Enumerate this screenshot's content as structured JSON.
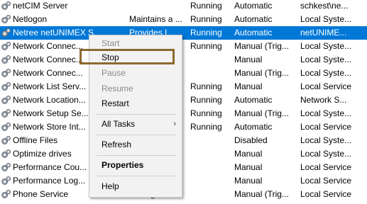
{
  "services": [
    {
      "name": "netCIM Server",
      "description": "",
      "status": "Running",
      "startup": "Automatic",
      "logon": "schkest\\ne..."
    },
    {
      "name": "Netlogon",
      "description": "Maintains a ...",
      "status": "Running",
      "startup": "Automatic",
      "logon": "Local Syste..."
    },
    {
      "name": "Netree netUNIMEX S...",
      "description": "Provides I...",
      "status": "Running",
      "startup": "Automatic",
      "logon": "netUNIME..."
    },
    {
      "name": "Network Connec...",
      "description": "",
      "status": "Running",
      "startup": "Manual (Trig...",
      "logon": "Local Syste..."
    },
    {
      "name": "Network Connec...",
      "description": "",
      "status": "",
      "startup": "Manual",
      "logon": "Local Syste..."
    },
    {
      "name": "Network Connec...",
      "description": "",
      "status": "",
      "startup": "Manual (Trig...",
      "logon": "Local Syste..."
    },
    {
      "name": "Network List Serv...",
      "description": "",
      "status": "Running",
      "startup": "Manual",
      "logon": "Local Service"
    },
    {
      "name": "Network Location...",
      "description": "",
      "status": "Running",
      "startup": "Automatic",
      "logon": "Network S..."
    },
    {
      "name": "Network Setup Se...",
      "description": "",
      "status": "Running",
      "startup": "Manual (Trig...",
      "logon": "Local Syste..."
    },
    {
      "name": "Network Store Int...",
      "description": "",
      "status": "Running",
      "startup": "Automatic",
      "logon": "Local Service"
    },
    {
      "name": "Offline Files",
      "description": "",
      "status": "",
      "startup": "Disabled",
      "logon": "Local Syste..."
    },
    {
      "name": "Optimize drives",
      "description": "",
      "status": "",
      "startup": "Manual",
      "logon": "Local Syste..."
    },
    {
      "name": "Performance Cou...",
      "description": "",
      "status": "",
      "startup": "Manual",
      "logon": "Local Service"
    },
    {
      "name": "Performance Log...",
      "description": "",
      "status": "",
      "startup": "Manual",
      "logon": "Local Service"
    },
    {
      "name": "Phone Service",
      "description": "Manages th...",
      "status": "",
      "startup": "Manual (Trig...",
      "logon": "Local Service"
    }
  ],
  "selected_index": 2,
  "context_menu": {
    "start": "Start",
    "stop": "Stop",
    "pause": "Pause",
    "resume": "Resume",
    "restart": "Restart",
    "all_tasks": "All Tasks",
    "all_tasks_arrow": "›",
    "refresh": "Refresh",
    "properties": "Properties",
    "help": "Help"
  },
  "colors": {
    "selection": "#0078d7",
    "highlight_box": "#8b6a2e"
  },
  "icons": {
    "service": "gear-icon",
    "submenu": "chevron-right-icon"
  }
}
